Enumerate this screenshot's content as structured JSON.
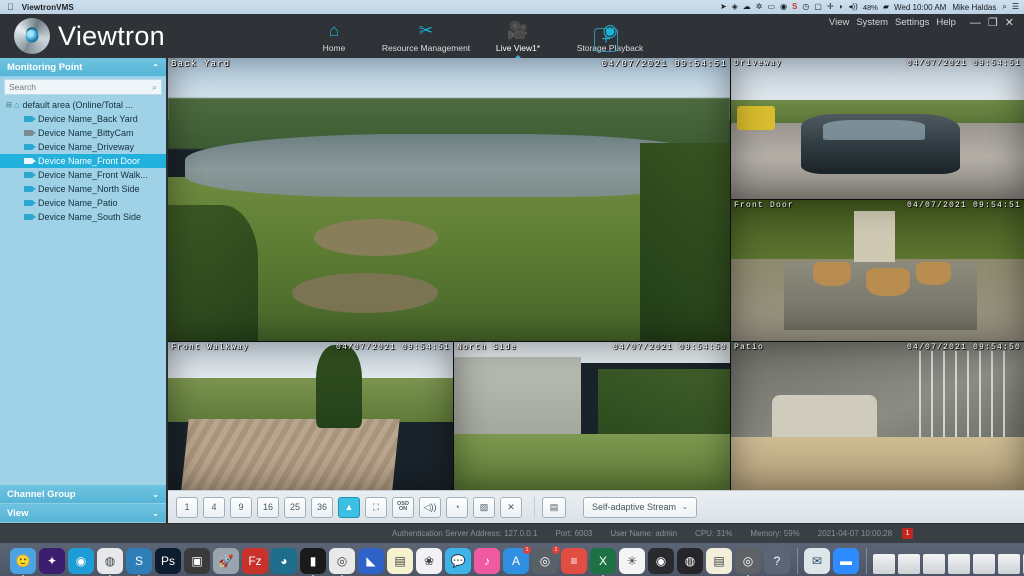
{
  "os_menubar": {
    "apple_glyph": "",
    "app_name": "ViewtronVMS",
    "status_icons": [
      "airplay-icon",
      "dropbox-icon",
      "cloud-icon",
      "slack-icon",
      "screen-icon",
      "camera-icon",
      "shortcut-s-icon",
      "clock-icon",
      "display-icon",
      "bluetooth-icon",
      "wifi-icon",
      "volume-icon"
    ],
    "battery": "48%",
    "clock": "Wed 10:00 AM",
    "user": "Mike Haldas",
    "search_glyph": "⌕",
    "controlcenter_glyph": "☰"
  },
  "app": {
    "brand": "Viewtron",
    "nav": [
      {
        "label": "Home",
        "icon": "home-icon",
        "glyph": "⌂",
        "active": false
      },
      {
        "label": "Resource Management",
        "icon": "tools-icon",
        "glyph": "✂",
        "active": false
      },
      {
        "label": "Live View1*",
        "icon": "video-camera-icon",
        "glyph": "▬",
        "active": true
      },
      {
        "label": "Storage Playback",
        "icon": "film-reel-icon",
        "glyph": "◉",
        "active": false
      }
    ],
    "add_tab_label": "+",
    "window_menu": [
      "View",
      "System",
      "Settings",
      "Help"
    ],
    "window_buttons": [
      {
        "name": "minimize-button",
        "glyph": "—"
      },
      {
        "name": "maximize-button",
        "glyph": "❐"
      },
      {
        "name": "close-button",
        "glyph": "✕"
      }
    ],
    "accent_color": "#18b5d8"
  },
  "sidebar": {
    "monitoring_point": {
      "title": "Monitoring Point",
      "collapse_glyph": "⌃",
      "search_placeholder": "Search",
      "search_value": "",
      "search_icon_glyph": "⌕",
      "root": {
        "label": "default area (Online/Total ...",
        "expander": "⊟",
        "icon": "home-area-icon"
      },
      "devices": [
        {
          "label": "Device Name_Back Yard",
          "online": true,
          "selected": false
        },
        {
          "label": "Device Name_BittyCam",
          "online": false,
          "selected": false
        },
        {
          "label": "Device Name_Driveway",
          "online": true,
          "selected": false
        },
        {
          "label": "Device Name_Front Door",
          "online": true,
          "selected": true
        },
        {
          "label": "Device Name_Front Walk...",
          "online": true,
          "selected": false
        },
        {
          "label": "Device Name_North Side",
          "online": true,
          "selected": false
        },
        {
          "label": "Device Name_Patio",
          "online": true,
          "selected": false
        },
        {
          "label": "Device Name_South Side",
          "online": true,
          "selected": false
        }
      ]
    },
    "channel_group": {
      "title": "Channel Group",
      "collapse_glyph": "⌄"
    },
    "view": {
      "title": "View",
      "collapse_glyph": "⌄"
    }
  },
  "video_grid": {
    "layout": "1+5",
    "cells": [
      {
        "name": "Back Yard",
        "timestamp": "04/07/2021 09:54:51",
        "scene": "backyard"
      },
      {
        "name": "Driveway",
        "timestamp": "04/07/2021 09:54:51",
        "scene": "driveway"
      },
      {
        "name": "Front Door",
        "timestamp": "04/07/2021 09:54:51",
        "scene": "frontdoor"
      },
      {
        "name": "Front Walkway",
        "timestamp": "04/07/2021 09:54:51",
        "scene": "walkway"
      },
      {
        "name": "North Side",
        "timestamp": "04/07/2021 09:54:50",
        "scene": "northside"
      },
      {
        "name": "Patio",
        "timestamp": "04/07/2021 09:54:50",
        "scene": "patio"
      }
    ]
  },
  "toolbar": {
    "layouts": [
      {
        "label": "1",
        "active": true
      },
      {
        "label": "4",
        "active": false
      },
      {
        "label": "9",
        "active": false
      },
      {
        "label": "16",
        "active": false
      },
      {
        "label": "25",
        "active": false
      },
      {
        "label": "36",
        "active": false
      }
    ],
    "tools": [
      {
        "name": "aspect-ratio-button",
        "glyph": "▲",
        "active": true,
        "label": ""
      },
      {
        "name": "fullscreen-button",
        "glyph": "⛶",
        "active": false,
        "label": ""
      },
      {
        "name": "osd-toggle-button",
        "glyph": "",
        "active": false,
        "label": "OSD ON"
      },
      {
        "name": "audio-button",
        "glyph": "🔊",
        "active": false,
        "label": ""
      },
      {
        "name": "snapshot-button",
        "glyph": "⏺",
        "active": false,
        "label": ""
      },
      {
        "name": "ptz-disable-button",
        "glyph": "▧",
        "active": false,
        "label": ""
      },
      {
        "name": "close-all-button",
        "glyph": "✕",
        "active": false,
        "label": ""
      }
    ],
    "custom_layout": {
      "name": "custom-layout-button",
      "glyph": "▤"
    },
    "stream": {
      "label": "Self-adaptive Stream",
      "chevron": "⌄"
    }
  },
  "statusbar": {
    "auth_server": "Authentication Server Address: 127.0.0.1",
    "port": "Port: 6003",
    "user_name": "User Name: admin",
    "cpu": "CPU: 31%",
    "memory": "Memory: 59%",
    "datetime": "2021-04-07 10:00:28",
    "alert_count": "1"
  },
  "dock": {
    "icons": [
      {
        "name": "finder",
        "glyph": "🙂",
        "color": "#4ba3e3",
        "running": true,
        "badge": ""
      },
      {
        "name": "app-purple",
        "glyph": "✦",
        "color": "#3b1e6e",
        "running": false,
        "badge": ""
      },
      {
        "name": "app-teal",
        "glyph": "◉",
        "color": "#1d9cd6",
        "running": false,
        "badge": ""
      },
      {
        "name": "app-pink",
        "glyph": "◍",
        "color": "#e8e8ea",
        "running": true,
        "badge": ""
      },
      {
        "name": "sublime",
        "glyph": "S",
        "color": "#2e7fb8",
        "running": true,
        "badge": ""
      },
      {
        "name": "photoshop",
        "glyph": "Ps",
        "color": "#0b1d2e",
        "running": false,
        "badge": ""
      },
      {
        "name": "app-orange",
        "glyph": "▣",
        "color": "#3a3a3a",
        "running": false,
        "badge": ""
      },
      {
        "name": "launchpad",
        "glyph": "🚀",
        "color": "#9aa4ad",
        "running": false,
        "badge": ""
      },
      {
        "name": "filezilla",
        "glyph": "Fz",
        "color": "#c8322b",
        "running": false,
        "badge": ""
      },
      {
        "name": "app-globe",
        "glyph": "◕",
        "color": "#1c6e8c",
        "running": false,
        "badge": ""
      },
      {
        "name": "terminal",
        "glyph": "▮",
        "color": "#1a1a1a",
        "running": true,
        "badge": ""
      },
      {
        "name": "chrome",
        "glyph": "◎",
        "color": "#e9e9ea",
        "running": true,
        "badge": ""
      },
      {
        "name": "app-blue",
        "glyph": "◣",
        "color": "#2f63c7",
        "running": false,
        "badge": ""
      },
      {
        "name": "notes",
        "glyph": "▤",
        "color": "#f6f1cf",
        "running": false,
        "badge": ""
      },
      {
        "name": "photos",
        "glyph": "❀",
        "color": "#f2f2f4",
        "running": false,
        "badge": ""
      },
      {
        "name": "messages",
        "glyph": "💬",
        "color": "#3fb2e8",
        "running": false,
        "badge": ""
      },
      {
        "name": "itunes",
        "glyph": "♪",
        "color": "#ef5aa0",
        "running": false,
        "badge": ""
      },
      {
        "name": "app-store",
        "glyph": "A",
        "color": "#2f8fe0",
        "running": false,
        "badge": "1"
      },
      {
        "name": "viewtron",
        "glyph": "◎",
        "color": "#5a6068",
        "running": false,
        "badge": "1"
      },
      {
        "name": "todoist",
        "glyph": "≡",
        "color": "#e24d41",
        "running": false,
        "badge": ""
      },
      {
        "name": "excel",
        "glyph": "X",
        "color": "#1e7145",
        "running": true,
        "badge": ""
      },
      {
        "name": "slack",
        "glyph": "✳",
        "color": "#f4f4f5",
        "running": false,
        "badge": ""
      },
      {
        "name": "obs",
        "glyph": "◉",
        "color": "#2a2a2e",
        "running": false,
        "badge": ""
      },
      {
        "name": "film",
        "glyph": "◍",
        "color": "#26262a",
        "running": false,
        "badge": ""
      },
      {
        "name": "textedit",
        "glyph": "▤",
        "color": "#f2eeda",
        "running": false,
        "badge": ""
      },
      {
        "name": "viewtron-vms",
        "glyph": "◎",
        "color": "#5e6166",
        "running": true,
        "badge": ""
      },
      {
        "name": "help",
        "glyph": "?",
        "color": "#5b6576",
        "running": false,
        "badge": ""
      }
    ],
    "minimized": [
      {
        "name": "minimized-window-1"
      },
      {
        "name": "minimized-window-2"
      },
      {
        "name": "minimized-window-3"
      },
      {
        "name": "minimized-window-4"
      },
      {
        "name": "minimized-window-5"
      },
      {
        "name": "minimized-window-6"
      },
      {
        "name": "minimized-window-7"
      }
    ],
    "trash": {
      "name": "trash-icon",
      "glyph": "🗑"
    },
    "right_apps": [
      {
        "name": "mail-icon",
        "glyph": "✉",
        "color": "#dfe6ea"
      },
      {
        "name": "zoom-icon",
        "glyph": "▬",
        "color": "#2d8cff"
      }
    ]
  }
}
